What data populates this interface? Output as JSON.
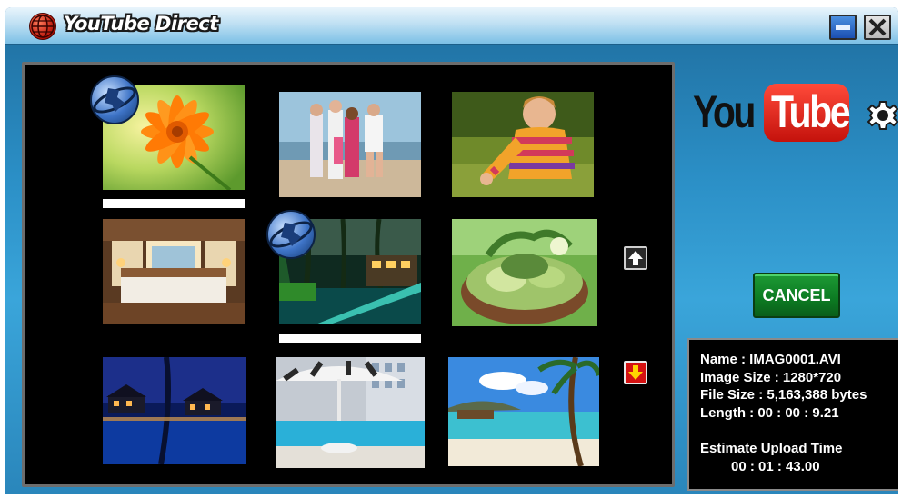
{
  "window": {
    "title": "YouTube Direct"
  },
  "icons": {
    "app": "globe-icon",
    "minimize": "minimize-icon",
    "close": "close-icon",
    "settings": "gear-icon",
    "scroll_up": "arrow-up-icon",
    "scroll_down": "arrow-down-icon",
    "video_badge": "video-globe-icon"
  },
  "brand": {
    "logo_you": "You",
    "logo_tube": "Tube",
    "colors": {
      "red": "#e62117",
      "green": "#0c7a22",
      "blue": "#2b8fc6"
    }
  },
  "gallery": {
    "thumbnails": [
      {
        "subject": "orange flower",
        "selected": true,
        "video": true
      },
      {
        "subject": "family on beach",
        "selected": false,
        "video": false
      },
      {
        "subject": "girl in striped sweater",
        "selected": false,
        "video": false
      },
      {
        "subject": "bedroom interior",
        "selected": false,
        "video": false
      },
      {
        "subject": "tropical pool at night",
        "selected": true,
        "video": true
      },
      {
        "subject": "basket of vegetables",
        "selected": false,
        "video": false
      },
      {
        "subject": "water villas at night",
        "selected": false,
        "video": false
      },
      {
        "subject": "pool with umbrella",
        "selected": false,
        "video": false
      },
      {
        "subject": "beach with palm tree",
        "selected": false,
        "video": false
      }
    ]
  },
  "actions": {
    "cancel_label": "CANCEL"
  },
  "file_info": {
    "name": "Name : IMAG0001.AVI",
    "image_size": "Image Size : 1280*720",
    "file_size": "File Size : 5,163,388 bytes",
    "length": "Length : 00 : 00 : 9.21",
    "estimate_label": "Estimate Upload Time",
    "estimate_value": "00 : 01 : 43.00"
  }
}
